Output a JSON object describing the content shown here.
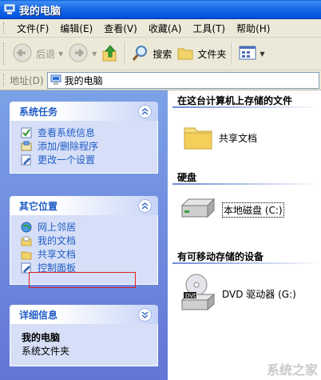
{
  "window": {
    "title": "我的电脑"
  },
  "menu": [
    "文件(F)",
    "编辑(E)",
    "查看(V)",
    "收藏(A)",
    "工具(T)",
    "帮助(H)"
  ],
  "toolbar": {
    "back_label": "后退",
    "search_label": "搜索",
    "folders_label": "文件夹"
  },
  "address": {
    "label": "地址(D)",
    "value": "我的电脑"
  },
  "system_tasks": {
    "title": "系统任务",
    "items": [
      "查看系统信息",
      "添加/删除程序",
      "更改一个设置"
    ]
  },
  "other_places": {
    "title": "其它位置",
    "items": [
      "网上邻居",
      "我的文档",
      "共享文档",
      "控制面板"
    ]
  },
  "details": {
    "title": "详细信息",
    "name": "我的电脑",
    "type": "系统文件夹"
  },
  "groups": {
    "stored_files": {
      "title": "在这台计算机上存储的文件",
      "items": [
        "共享文档"
      ]
    },
    "hard_disks": {
      "title": "硬盘",
      "items": [
        "本地磁盘 (C:)"
      ]
    },
    "removable": {
      "title": "有可移动存储的设备",
      "items": [
        "DVD 驱动器 (G:)"
      ]
    }
  },
  "watermark": "系统之家",
  "colors": {
    "titlebar": "#0054e3",
    "task_link": "#215dc6",
    "highlight_box": "#e02020"
  }
}
